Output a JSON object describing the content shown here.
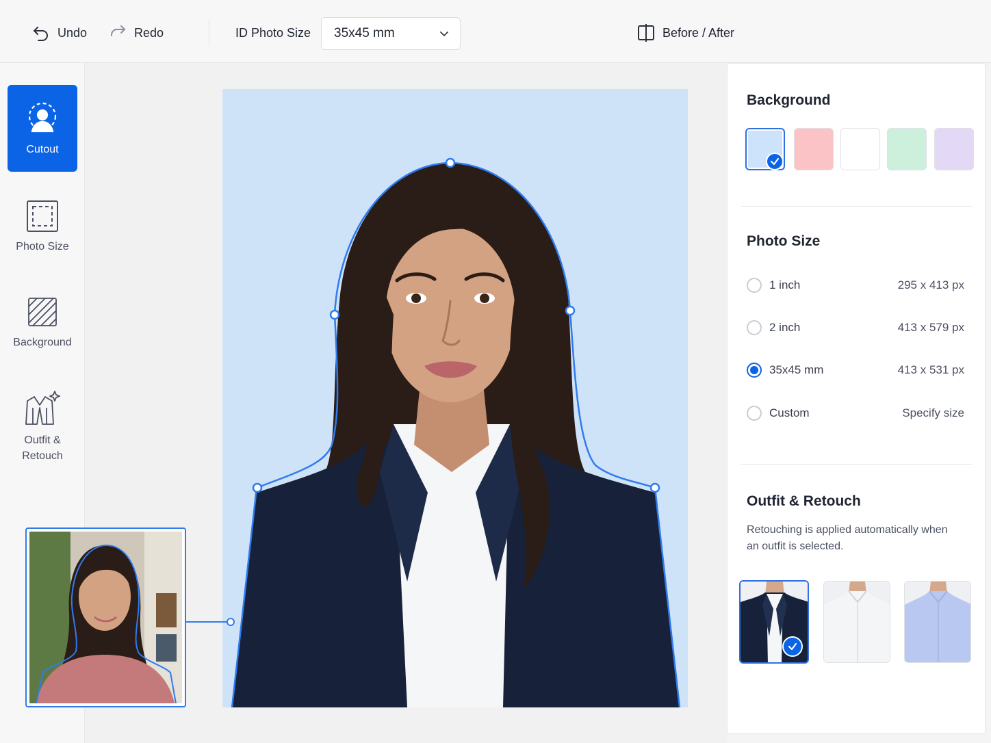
{
  "toolbar": {
    "undo_label": "Undo",
    "redo_label": "Redo",
    "size_label": "ID Photo Size",
    "size_select_value": "35x45 mm",
    "before_after_label": "Before / After"
  },
  "sidebar": {
    "items": [
      {
        "label": "Cutout",
        "icon": "person-cutout-icon",
        "active": true
      },
      {
        "label": "Photo Size",
        "icon": "crop-frame-icon",
        "active": false
      },
      {
        "label": "Background",
        "icon": "hatched-square-icon",
        "active": false
      },
      {
        "label_line1": "Outfit &",
        "label_line2": "Retouch",
        "icon": "jacket-sparkle-icon",
        "active": false
      }
    ]
  },
  "panel": {
    "background": {
      "title": "Background",
      "swatches": [
        {
          "color": "#cde3fb",
          "selected": true
        },
        {
          "color": "#fbc3c5",
          "selected": false
        },
        {
          "color": "#ffffff",
          "selected": false
        },
        {
          "color": "#cdf0dc",
          "selected": false
        },
        {
          "color": "#e3d9f7",
          "selected": false
        }
      ]
    },
    "photo_size": {
      "title": "Photo Size",
      "options": [
        {
          "label": "1 inch",
          "px": "295 x 413 px",
          "selected": false
        },
        {
          "label": "2 inch",
          "px": "413 x 579 px",
          "selected": false
        },
        {
          "label": "35x45 mm",
          "px": "413 x 531 px",
          "selected": true
        },
        {
          "label": "Custom",
          "px": "Specify size",
          "selected": false
        }
      ]
    },
    "outfit": {
      "title": "Outfit & Retouch",
      "description": "Retouching is applied automatically when an outfit is selected.",
      "options": [
        {
          "name": "dark-blazer",
          "selected": true
        },
        {
          "name": "white-shirt",
          "selected": false
        },
        {
          "name": "light-blue-shirt",
          "selected": false
        }
      ]
    }
  },
  "colors": {
    "accent": "#0b63e5",
    "photo_background": "#cfe3f8",
    "outline": "#2f7bef"
  }
}
